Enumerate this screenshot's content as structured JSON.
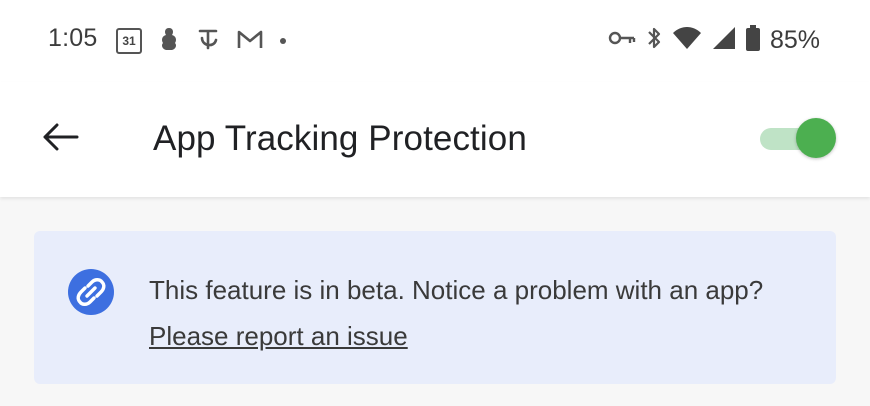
{
  "status_bar": {
    "time": "1:05",
    "calendar_day": "31",
    "battery_percent": "85%",
    "left_icons": [
      "calendar-icon",
      "app-notification-icon",
      "nyt-icon",
      "gmail-icon",
      "more-dot-icon"
    ],
    "right_icons": [
      "vpn-key-icon",
      "bluetooth-icon",
      "wifi-icon",
      "cell-signal-icon",
      "battery-icon"
    ]
  },
  "app_bar": {
    "title": "App Tracking Protection",
    "toggle_on": true,
    "colors": {
      "toggle_thumb": "#4caf50",
      "toggle_track": "#bfe3c6"
    }
  },
  "banner": {
    "text_prefix": "This feature is in beta. Notice a problem with an app?",
    "link_text": "Please report an issue",
    "background": "#e8edfb",
    "icon_color": "#3d6fe0",
    "icon": "link-icon"
  }
}
